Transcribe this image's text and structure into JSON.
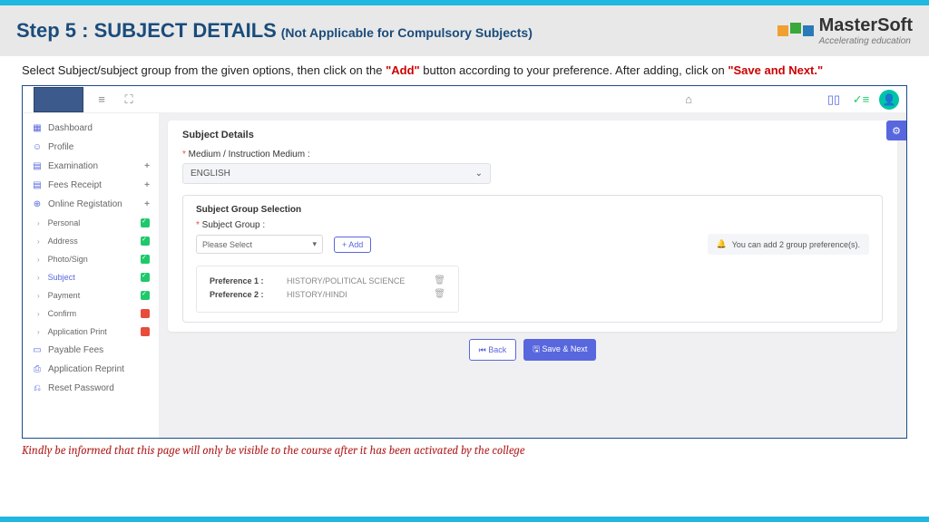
{
  "header": {
    "step": "Step 5 : SUBJECT DETAILS",
    "subtitle": "(Not Applicable for Compulsory Subjects)",
    "brand": "MasterSoft",
    "tagline": "Accelerating education"
  },
  "instruction": {
    "pre": "Select Subject/subject group from the given options, then click on the ",
    "add": "\"Add\"",
    "mid": " button according to your preference. After adding, click on ",
    "save": "\"Save and Next.\""
  },
  "sidebar": {
    "items": [
      {
        "icon": "▦",
        "label": "Dashboard"
      },
      {
        "icon": "☺",
        "label": "Profile"
      },
      {
        "icon": "▤",
        "label": "Examination",
        "plus": "+"
      },
      {
        "icon": "▤",
        "label": "Fees Receipt",
        "plus": "+"
      },
      {
        "icon": "⊕",
        "label": "Online Registation",
        "plus": "+"
      }
    ],
    "subs": [
      {
        "label": "Personal",
        "status": "green"
      },
      {
        "label": "Address",
        "status": "green"
      },
      {
        "label": "Photo/Sign",
        "status": "green"
      },
      {
        "label": "Subject",
        "status": "green",
        "active": true
      },
      {
        "label": "Payment",
        "status": "green"
      },
      {
        "label": "Confirm",
        "status": "red"
      },
      {
        "label": "Application Print",
        "status": "red"
      }
    ],
    "tail": [
      {
        "icon": "▭",
        "label": "Payable Fees"
      },
      {
        "icon": "⎙",
        "label": "Application Reprint"
      },
      {
        "icon": "⎌",
        "label": "Reset Password"
      }
    ]
  },
  "main": {
    "card_title": "Subject Details",
    "medium_label": "Medium / Instruction Medium :",
    "medium_value": "ENGLISH",
    "group_title": "Subject Group Selection",
    "group_label": "Subject Group :",
    "group_placeholder": "Please Select",
    "add_btn": "+ Add",
    "alert": "You can add 2 group preference(s).",
    "prefs": [
      {
        "label": "Preference 1 :",
        "value": "HISTORY/POLITICAL SCIENCE"
      },
      {
        "label": "Preference 2 :",
        "value": "HISTORY/HINDI"
      }
    ],
    "back": "⏮ Back",
    "save": "🖫 Save & Next"
  },
  "footer": "Kindly be informed that this page will only be visible to the course after it has been activated by the college"
}
